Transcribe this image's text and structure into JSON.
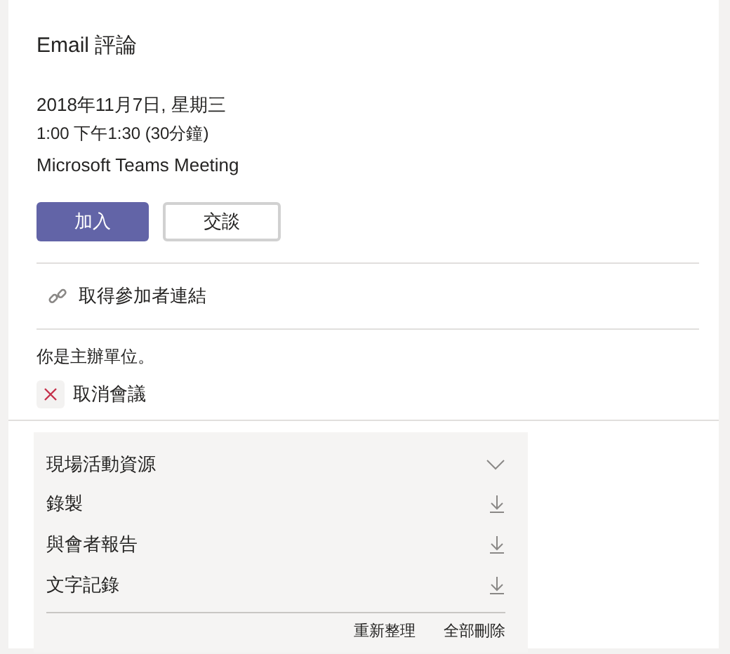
{
  "title": "Email 評論",
  "date": "2018年11月7日, 星期三",
  "time": "1:00 下午1:30 (30分鐘)",
  "location": "Microsoft Teams Meeting",
  "buttons": [
    {
      "label": "加入",
      "kind": "primary"
    },
    {
      "label": "交談",
      "kind": "secondary"
    }
  ],
  "attendee_link": "取得參加者連結",
  "organizer_note": "你是主辦單位。",
  "cancel": "取消會議",
  "resources": {
    "title": "現場活動資源",
    "expanded": true,
    "items": [
      {
        "label": "錄製"
      },
      {
        "label": "與會者報告"
      },
      {
        "label": "文字記錄"
      }
    ],
    "actions": [
      "重新整理",
      "全部刪除"
    ]
  }
}
